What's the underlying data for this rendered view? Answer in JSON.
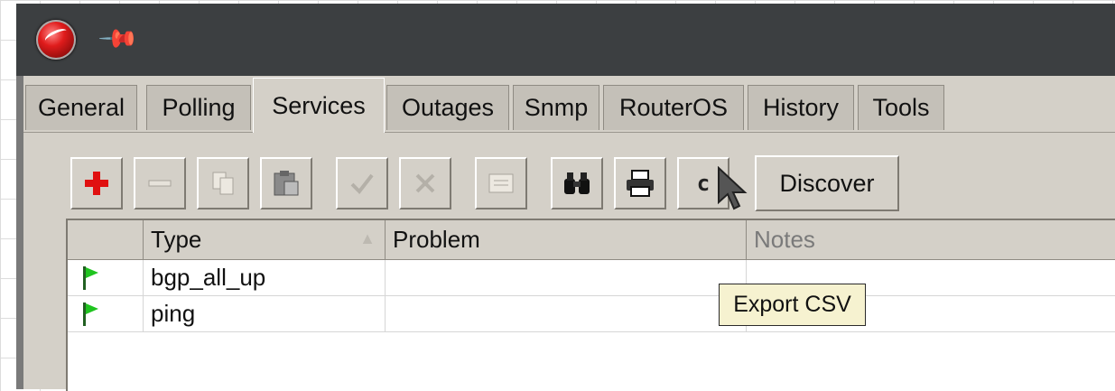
{
  "window": {
    "app_icon": "red-sphere-logo",
    "pin_icon": "pushpin-icon"
  },
  "tabs": [
    {
      "label": "General"
    },
    {
      "label": "Polling"
    },
    {
      "label": "Services"
    },
    {
      "label": "Outages"
    },
    {
      "label": "Snmp"
    },
    {
      "label": "RouterOS"
    },
    {
      "label": "History"
    },
    {
      "label": "Tools"
    }
  ],
  "active_tab": "Services",
  "toolbar": {
    "buttons": [
      {
        "icon": "add-icon",
        "enabled": true
      },
      {
        "icon": "remove-icon",
        "enabled": false
      },
      {
        "icon": "copy-icon",
        "enabled": false
      },
      {
        "icon": "paste-icon",
        "enabled": false
      },
      {
        "icon": "check-icon",
        "enabled": false
      },
      {
        "icon": "cancel-icon",
        "enabled": false
      },
      {
        "icon": "comment-icon",
        "enabled": false
      },
      {
        "icon": "find-icon",
        "enabled": true
      },
      {
        "icon": "print-icon",
        "enabled": true
      },
      {
        "icon": "export-csv-icon",
        "enabled": true,
        "glyph": "c"
      }
    ],
    "discover_label": "Discover",
    "tooltip": "Export CSV"
  },
  "table": {
    "columns": [
      "Type",
      "Problem",
      "Notes"
    ],
    "rows": [
      {
        "type": "bgp_all_up",
        "problem": "",
        "notes": "",
        "status_color": "#1fc41f"
      },
      {
        "type": "ping",
        "problem": "",
        "notes": "",
        "status_color": "#1fc41f"
      }
    ]
  }
}
